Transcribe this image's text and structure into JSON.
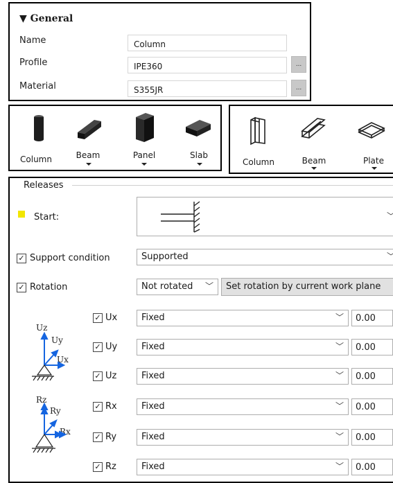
{
  "general": {
    "header": "▼ General",
    "fields": [
      {
        "label": "Name",
        "value": "Column"
      },
      {
        "label": "Profile",
        "value": "IPE360",
        "button": "..."
      },
      {
        "label": "Material",
        "value": "S355JR",
        "button": "..."
      }
    ]
  },
  "toolbar_left": {
    "items": [
      {
        "label": "Column",
        "icon": "solid-column-icon"
      },
      {
        "label": "Beam",
        "icon": "solid-beam-icon",
        "dropdown": true
      },
      {
        "label": "Panel",
        "icon": "solid-panel-icon",
        "dropdown": true
      },
      {
        "label": "Slab",
        "icon": "solid-slab-icon",
        "dropdown": true
      }
    ]
  },
  "toolbar_right": {
    "items": [
      {
        "label": "Column",
        "icon": "column-outline-icon"
      },
      {
        "label": "Beam",
        "icon": "beam-outline-icon",
        "dropdown": true
      },
      {
        "label": "Plate",
        "icon": "plate-outline-icon",
        "dropdown": true
      }
    ]
  },
  "releases": {
    "title": "Releases",
    "start_label": "Start:",
    "start_marker_color": "#f2e600",
    "support_condition": {
      "label": "Support condition",
      "checked": true,
      "value": "Supported"
    },
    "rotation": {
      "label": "Rotation",
      "checked": true,
      "value": "Not rotated",
      "button": "Set rotation by current work plane"
    },
    "translation_axes": {
      "uz": "Uz",
      "uy": "Uy",
      "ux": "Ux"
    },
    "rotation_axes": {
      "rz": "Rz",
      "ry": "Ry",
      "rx": "Rx"
    },
    "dofs": [
      {
        "label": "Ux",
        "checked": true,
        "value": "Fixed",
        "number": "0.00"
      },
      {
        "label": "Uy",
        "checked": true,
        "value": "Fixed",
        "number": "0.00"
      },
      {
        "label": "Uz",
        "checked": true,
        "value": "Fixed",
        "number": "0.00"
      },
      {
        "label": "Rx",
        "checked": true,
        "value": "Fixed",
        "number": "0.00"
      },
      {
        "label": "Ry",
        "checked": true,
        "value": "Fixed",
        "number": "0.00"
      },
      {
        "label": "Rz",
        "checked": true,
        "value": "Fixed",
        "number": "0.00"
      }
    ]
  }
}
